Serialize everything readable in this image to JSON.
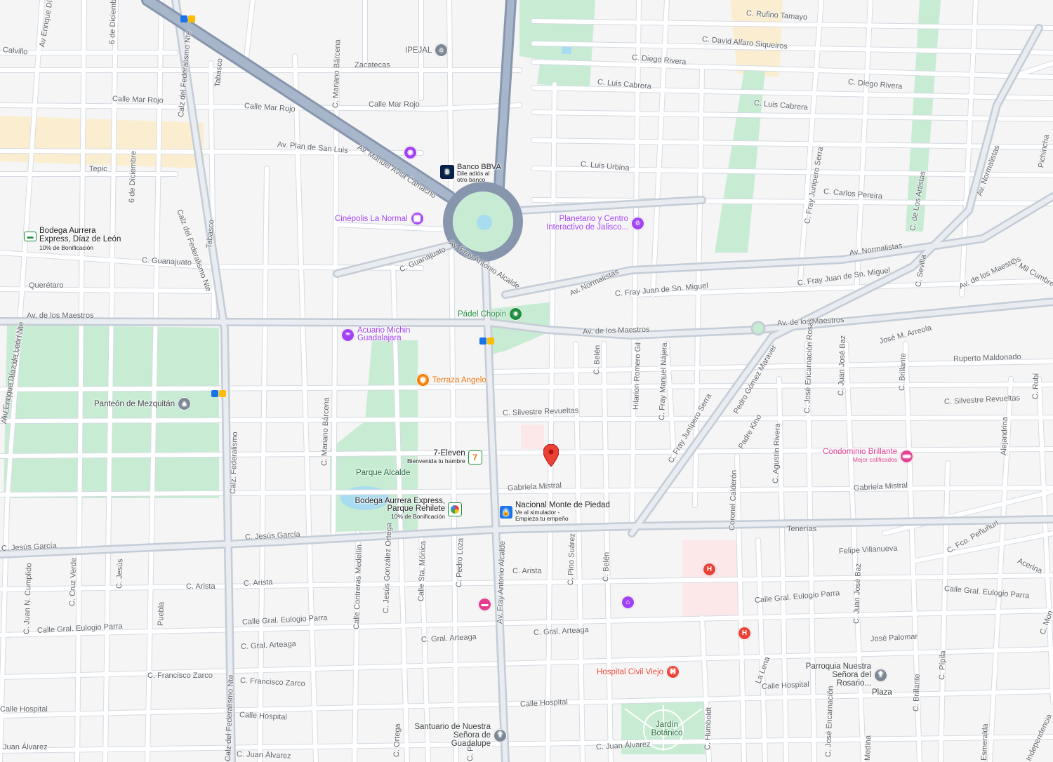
{
  "colors": {
    "background": "#f5f5f5",
    "road": "#ffffff",
    "road_outline": "#d5dbe3",
    "avenue": "#c9d0da",
    "highway": "#9aa9bf",
    "park": "#c8ecd3",
    "zone_beige": "#fbeed0",
    "water": "#a8dcf0",
    "purple_poi": "#a142f4",
    "hospital": "#ea4335",
    "food": "#f57c00",
    "pink": "#e53c8f",
    "grey_poi": "#7b8794",
    "green_poi": "#1e8e3e"
  },
  "streets": [
    {
      "name": "Calvillo"
    },
    {
      "name": "Av Enrique Díaz"
    },
    {
      "name": "6 de Diciembre"
    },
    {
      "name": "Calz del Federalismo Nte"
    },
    {
      "name": "Tabasco"
    },
    {
      "name": "Calle Mar Rojo"
    },
    {
      "name": "Calle Mar Rojo"
    },
    {
      "name": "Calle Mar Rojo"
    },
    {
      "name": "Zacatecas"
    },
    {
      "name": "C. Mariano Bárcena"
    },
    {
      "name": "Av. Plan de San Luis"
    },
    {
      "name": "Av. Manuel Ávila Camacho"
    },
    {
      "name": "Tepic"
    },
    {
      "name": "6 de Diciembre"
    },
    {
      "name": "Calz del Federalismo Nte"
    },
    {
      "name": "Tabasco"
    },
    {
      "name": "C. Guanajuato"
    },
    {
      "name": "C. Guanajuato"
    },
    {
      "name": "Av. Fray Antonio Alcalde"
    },
    {
      "name": "Querétaro"
    },
    {
      "name": "Av. de los Maestros"
    },
    {
      "name": "Av Enrique Díaz de León Nte"
    },
    {
      "name": "C. Rufino Tamayo"
    },
    {
      "name": "C. David Alfaro Siqueiros"
    },
    {
      "name": "C. Diego Rivera"
    },
    {
      "name": "C. Luis Cabrera"
    },
    {
      "name": "C. Diego Rivera"
    },
    {
      "name": "C. Luis Cabrera"
    },
    {
      "name": "C. Luis Urbina"
    },
    {
      "name": "C. Fray Junipero Serra"
    },
    {
      "name": "C. Carlos Pereira"
    },
    {
      "name": "C. de Los Artistas"
    },
    {
      "name": "Av. Normalistas"
    },
    {
      "name": "Av. Normalistas"
    },
    {
      "name": "Av. Normalistas"
    },
    {
      "name": "Pichincha"
    },
    {
      "name": "C. Sevilla"
    },
    {
      "name": "Av. de los Maestros"
    },
    {
      "name": "C. Mil Cumbres"
    },
    {
      "name": "C. Fray Juan de Sn. Miguel"
    },
    {
      "name": "C. Fray Juan de Sn. Miguel"
    },
    {
      "name": "Av. de los Maestros"
    },
    {
      "name": "Av. de los Maestros"
    },
    {
      "name": "C. Belén"
    },
    {
      "name": "Hilarion Romero Gil"
    },
    {
      "name": "C. Fray Manuel Nájera"
    },
    {
      "name": "C. José Encarnación Rosas"
    },
    {
      "name": "C. Juan José Baz"
    },
    {
      "name": "C. Brillante"
    },
    {
      "name": "José M. Arreola"
    },
    {
      "name": "Ruperto Maldonado"
    },
    {
      "name": "C. Rubí"
    },
    {
      "name": "Pedro Gómez Maraver"
    },
    {
      "name": "C. Fray Junípero Serra"
    },
    {
      "name": "Padre Kino"
    },
    {
      "name": "C. Agustín Rivera"
    },
    {
      "name": "C. Silvestre Revueltas"
    },
    {
      "name": "C. Silvestre Revueltas"
    },
    {
      "name": "Alejandrina"
    },
    {
      "name": "C. Mariano Bárcena"
    },
    {
      "name": "Calz. Federalismo"
    },
    {
      "name": "Gabriela Mistral"
    },
    {
      "name": "Gabriela Mistral"
    },
    {
      "name": "Coronel Calderón"
    },
    {
      "name": "C. Jesús García"
    },
    {
      "name": "C. Jesús García"
    },
    {
      "name": "Tenerías"
    },
    {
      "name": "C. Fco. Peñuñuri"
    },
    {
      "name": "Felipe Villanueva"
    },
    {
      "name": "Acerina"
    },
    {
      "name": "Av Enrique Díaz de León Nte"
    },
    {
      "name": "C. Juan N. Cumplido"
    },
    {
      "name": "C. Cruz Verde"
    },
    {
      "name": "C. Jesús"
    },
    {
      "name": "Puebla"
    },
    {
      "name": "C. Arista"
    },
    {
      "name": "C. Arista"
    },
    {
      "name": "Calle Contreras Medellín"
    },
    {
      "name": "C. Jesús González Ortega"
    },
    {
      "name": "Calle Sta. Mónica"
    },
    {
      "name": "C. Pedro Loza"
    },
    {
      "name": "Av. Fray Antonio Alcalde"
    },
    {
      "name": "C. Arista"
    },
    {
      "name": "C. Pino Suárez"
    },
    {
      "name": "C. Belén"
    },
    {
      "name": "C. Juan José Baz"
    },
    {
      "name": "Calle Gral. Eulogio Parra"
    },
    {
      "name": "Calle Gral. Eulogio Parra"
    },
    {
      "name": "Calle Gral. Eulogio Parra"
    },
    {
      "name": "Calle Gral. Eulogio Parra"
    },
    {
      "name": "C. Gral. Arteaga"
    },
    {
      "name": "C. Gral. Arteaga"
    },
    {
      "name": "C. Gral. Arteaga"
    },
    {
      "name": "José Palomar"
    },
    {
      "name": "Calz del Federalismo Nte"
    },
    {
      "name": "C. Francisco Zarco"
    },
    {
      "name": "C. Francisco Zarco"
    },
    {
      "name": "Calle Hospital"
    },
    {
      "name": "Calle Hospital"
    },
    {
      "name": "Calle Hospital"
    },
    {
      "name": "Calle Hospital"
    },
    {
      "name": "C. Humboldt"
    },
    {
      "name": "La Lena"
    },
    {
      "name": "C. José Encarnación"
    },
    {
      "name": "C. Brillante"
    },
    {
      "name": "C. Pípila"
    },
    {
      "name": "Juan Álvarez"
    },
    {
      "name": "C. Juan Álvarez"
    },
    {
      "name": "C. Juan Álvarez"
    },
    {
      "name": "C. Ortega"
    },
    {
      "name": "Esmeralda"
    },
    {
      "name": "Independencia"
    },
    {
      "name": "Medina"
    },
    {
      "name": "C. Mon"
    },
    {
      "name": "C. Pe"
    }
  ],
  "pois": [
    {
      "key": "ipejal",
      "title": "IPEJAL",
      "sub": "",
      "icon": "building-icon"
    },
    {
      "key": "bbva",
      "title": "Banco BBVA",
      "sub": "Dile adiós al otro banco",
      "icon": "bank-icon"
    },
    {
      "key": "cinepolis",
      "title": "Cinépolis La Normal",
      "sub": "",
      "icon": "cinema-icon"
    },
    {
      "key": "planetario",
      "title": "Planetario y Centro Interactivo de Jalisco...",
      "sub": "",
      "icon": "museum-icon"
    },
    {
      "key": "bodega1",
      "title": "Bodega Aurrera Express, Díaz de León",
      "sub": "10% de Bonificación",
      "icon": "store-icon"
    },
    {
      "key": "padel",
      "title": "Pádel Chopin",
      "sub": "",
      "icon": "sports-icon"
    },
    {
      "key": "acuario",
      "title": "Acuario Michin Guadalajara",
      "sub": "",
      "icon": "aquarium-icon"
    },
    {
      "key": "terraza",
      "title": "Terraza Angelo",
      "sub": "",
      "icon": "restaurant-icon"
    },
    {
      "key": "panteon",
      "title": "Panteón de Mezquitán",
      "sub": "",
      "icon": "cemetery-icon"
    },
    {
      "key": "seven",
      "title": "7-Eleven",
      "sub": "Bienvenida tu hambre",
      "icon": "convenience-store-icon"
    },
    {
      "key": "parque",
      "title": "Parque Alcalde",
      "sub": "",
      "icon": ""
    },
    {
      "key": "bodega2",
      "title": "Bodega Aurrera Express, Parque Rehilete",
      "sub": "10% de Bonificación",
      "icon": "store-icon"
    },
    {
      "key": "monte",
      "title": "Nacional Monte de Piedad",
      "sub": "Ve al simulador - Empieza tu empeño",
      "icon": "pawn-shop-icon"
    },
    {
      "key": "condominio",
      "title": "Condominio Brillante",
      "sub": "Mejor calificados",
      "icon": "hotel-icon"
    },
    {
      "key": "hospital",
      "title": "Hospital Civil Viejo",
      "sub": "",
      "icon": "hospital-icon"
    },
    {
      "key": "santuario",
      "title": "Santuario de Nuestra Señora de Guadalupe",
      "sub": "",
      "icon": "church-icon"
    },
    {
      "key": "jardin",
      "title": "Jardín Botánico",
      "sub": "",
      "icon": ""
    },
    {
      "key": "parroquia",
      "title": "Parroquia Nuestra Señora del Rosario...",
      "sub": "",
      "icon": "church-icon"
    },
    {
      "key": "plaza",
      "title": "Plaza",
      "sub": "",
      "icon": ""
    }
  ],
  "metro_badges": [
    "L",
    "T"
  ],
  "selected_pin": {
    "icon": "location-pin-icon"
  }
}
